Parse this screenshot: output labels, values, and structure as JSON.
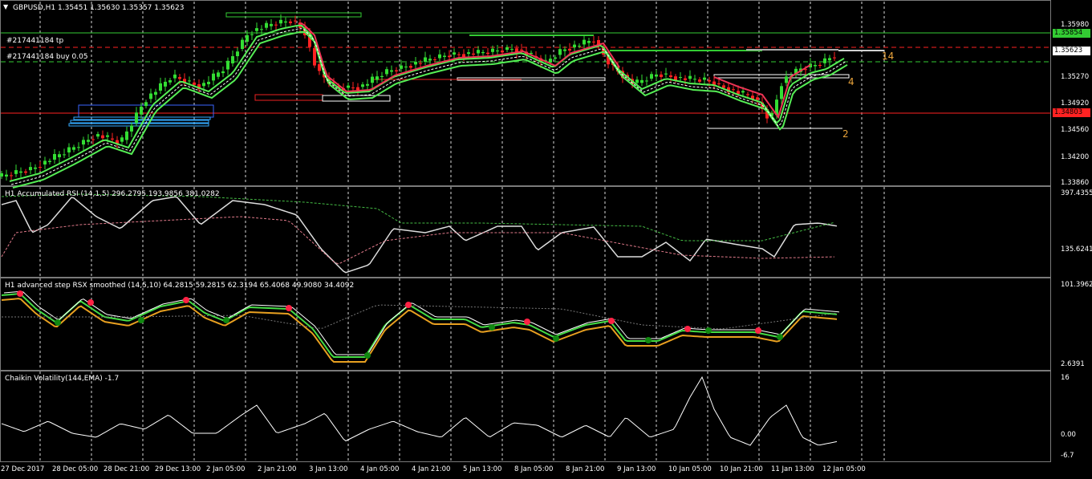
{
  "chart_header": {
    "menu_arrow": "triangle-down-icon",
    "symbol_line": "GBPUSD,H1  1.35451 1.35630 1.35357 1.35623",
    "order_tp_label": "#217441184 tp",
    "order_buy_label": "#217441184 buy 0.05"
  },
  "price_scale": {
    "ticks": [
      "1.35980",
      "1.35270",
      "1.34920",
      "1.34560",
      "1.34200",
      "1.33860"
    ],
    "tp_box": "1.35854",
    "current_box": "1.35623",
    "sl_box": "1.34803"
  },
  "level_markers": {
    "m1": "14",
    "m2": "4",
    "m3": "2"
  },
  "rsi_pane": {
    "title": "H1 Accumulated RSI (14,1,5) 296.2795 193.9856 381.0282",
    "scale_top": "397.4355",
    "scale_bottom": "135.6241"
  },
  "rsx_pane": {
    "title": "H1 advanced step RSX smoothed (14,5,10) 64.2815 59.2815 62.3194 65.4068 49.9080 34.4092",
    "scale_top": "101.3962",
    "scale_bottom": "2.6391"
  },
  "chaikin_pane": {
    "title": "Chaikin Volatility(144,EMA) -1.7",
    "scale_top": "16",
    "scale_mid": "0.00",
    "scale_bottom": "-6.7"
  },
  "time_axis": {
    "labels": [
      "27 Dec 2017",
      "28 Dec 05:00",
      "28 Dec 21:00",
      "29 Dec 13:00",
      "2 Jan 05:00",
      "2 Jan 21:00",
      "3 Jan 13:00",
      "4 Jan 05:00",
      "4 Jan 21:00",
      "5 Jan 13:00",
      "8 Jan 05:00",
      "8 Jan 21:00",
      "9 Jan 13:00",
      "10 Jan 05:00",
      "10 Jan 21:00",
      "11 Jan 13:00",
      "12 Jan 05:00"
    ]
  },
  "colors": {
    "background": "#000000",
    "bull_candle": "#33dd33",
    "bear_candle": "#ff2222",
    "tp_line": "#33cc33",
    "sl_line": "#ff2222",
    "ma_green": "#55ee55",
    "ma_red": "#ee3355"
  }
}
